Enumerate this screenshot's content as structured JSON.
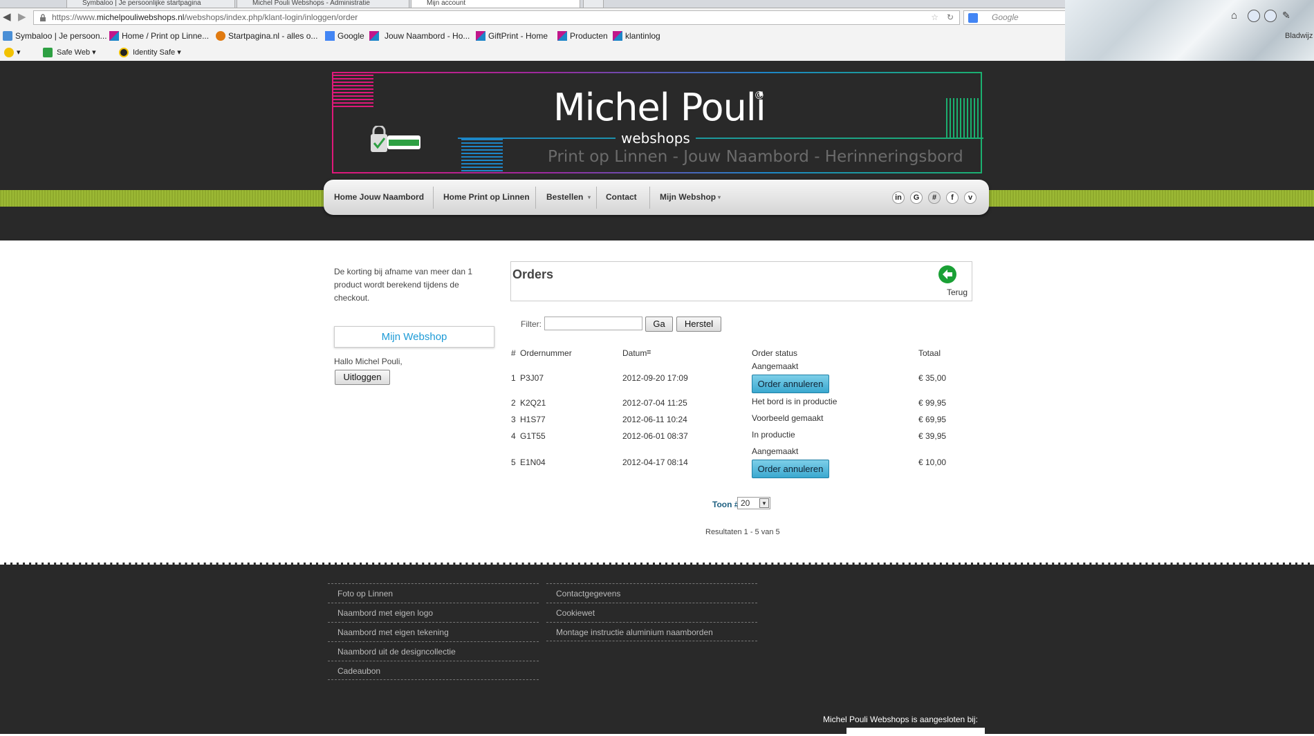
{
  "browser": {
    "tabs": [
      "Symbaloo | Je persoonlijke startpagina",
      "Michel Pouli Webshops - Administratie",
      "Mijn account"
    ],
    "url_prefix": "https://www.",
    "url_domain": "michelpouliwebshops.nl",
    "url_path": "/webshops/index.php/klant-login/inloggen/order",
    "search_placeholder": "Google",
    "bookmarks": [
      "Symbaloo | Je persoon...",
      "Home / Print op Linne...",
      "Startpagina.nl - alles o...",
      "Google",
      "Jouw Naambord - Ho...",
      "GiftPrint - Home",
      "Producten",
      "klantinlog"
    ],
    "toolbar": [
      "Safe Web",
      "Identity Safe"
    ],
    "bladwijzers": "Bladwijz",
    "colors": {
      "bookmark_icon": "#c0178a",
      "ok_badge": "#2ea043"
    }
  },
  "header": {
    "brand": "Michel Pouli",
    "copyright": "©",
    "subtitle": "webshops",
    "tagline": "Print op Linnen - Jouw Naambord - Herinneringsbord",
    "colors": {
      "pink": "#e0187a",
      "blue": "#1d86c8",
      "green": "#1bb070",
      "lime_bar": "#9cb935"
    }
  },
  "nav": {
    "items": [
      "Home Jouw Naambord",
      "Home Print op Linnen",
      "Bestellen",
      "Contact",
      "Mijn Webshop"
    ],
    "social": [
      "in",
      "G",
      "#",
      "f",
      "v"
    ]
  },
  "sidebar": {
    "note": "De korting bij afname van meer dan 1 product wordt berekend tijdens de checkout.",
    "box_title": "Mijn Webshop",
    "greeting": "Hallo Michel Pouli,",
    "logout": "Uitloggen"
  },
  "orders": {
    "title": "Orders",
    "back": "Terug",
    "filter_label": "Filter:",
    "go": "Ga",
    "reset": "Herstel",
    "columns": {
      "num": "#",
      "order": "Ordernummer",
      "date": "Datum",
      "status": "Order status",
      "total": "Totaal"
    },
    "cancel_label": "Order annuleren",
    "rows": [
      {
        "n": "1",
        "order": "P3J07",
        "date": "2012-09-20 17:09",
        "status": "Aangemaakt",
        "total": "€ 35,00"
      },
      {
        "n": "2",
        "order": "K2Q21",
        "date": "2012-07-04 11:25",
        "status": "Het bord is in productie",
        "total": "€ 99,95"
      },
      {
        "n": "3",
        "order": "H1S77",
        "date": "2012-06-11 10:24",
        "status": "Voorbeeld gemaakt",
        "total": "€ 69,95"
      },
      {
        "n": "4",
        "order": "G1T55",
        "date": "2012-06-01 08:37",
        "status": "In productie",
        "total": "€ 39,95"
      },
      {
        "n": "5",
        "order": "E1N04",
        "date": "2012-04-17 08:14",
        "status": "Aangemaakt",
        "total": "€ 10,00"
      }
    ],
    "show_label": "Toon #",
    "show_value": "20",
    "results": "Resultaten 1 - 5 van 5"
  },
  "footer": {
    "col1": [
      "Foto op Linnen",
      "Naambord met eigen logo",
      "Naambord met eigen tekening",
      "Naambord uit de designcollectie",
      "Cadeaubon"
    ],
    "col2": [
      "Contactgegevens",
      "Cookiewet",
      "Montage instructie aluminium naamborden"
    ],
    "affiliation": "Michel Pouli Webshops is aangesloten bij:"
  }
}
